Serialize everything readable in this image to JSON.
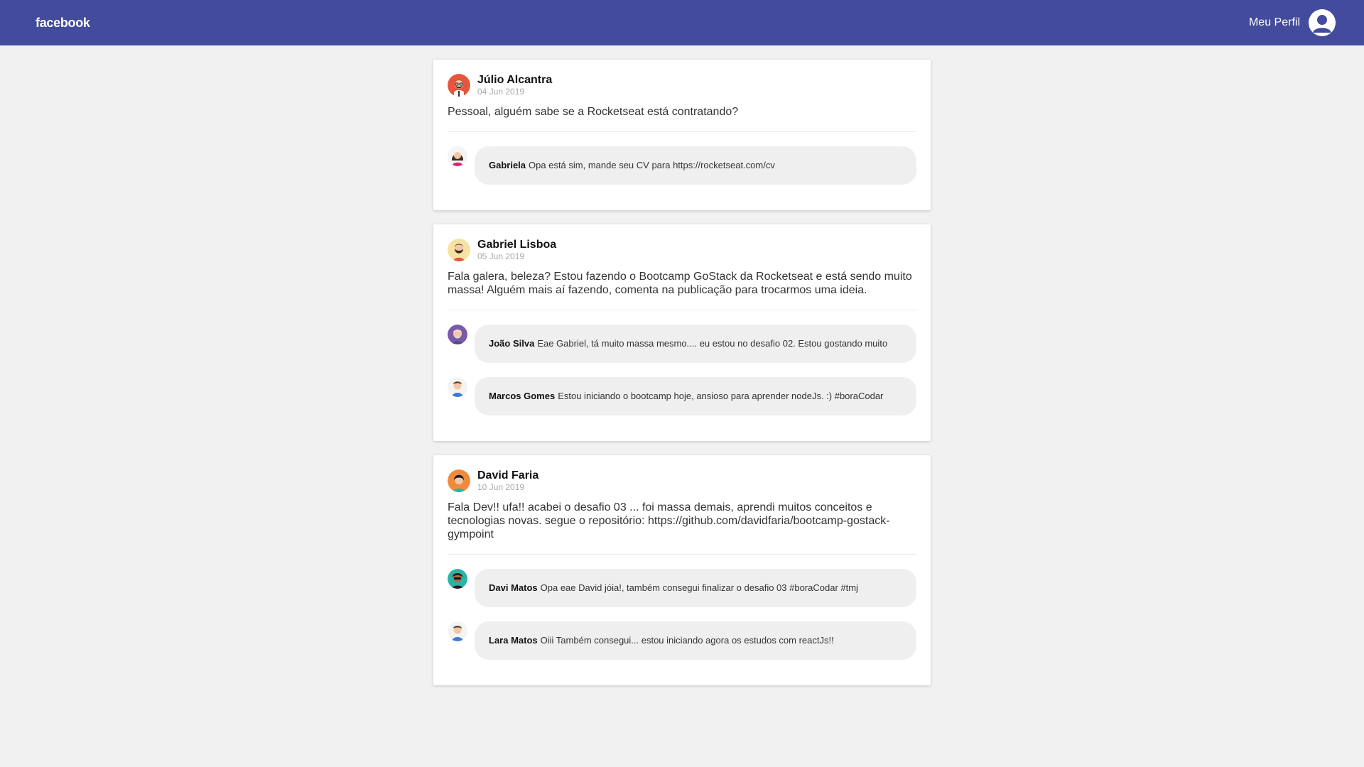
{
  "header": {
    "logo": "facebook",
    "profile_label": "Meu Perfil"
  },
  "posts": [
    {
      "author": "Júlio Alcantra",
      "date": "04 Jun 2019",
      "content": "Pessoal, alguém sabe se a Rocketseat está contratando?",
      "comments": [
        {
          "author": "Gabriela",
          "text": "Opa está sim, mande seu CV para https://rocketseat.com/cv"
        }
      ]
    },
    {
      "author": "Gabriel Lisboa",
      "date": "05 Jun 2019",
      "content": "Fala galera, beleza? Estou fazendo o Bootcamp GoStack da Rocketseat e está sendo muito massa! Alguém mais aí fazendo, comenta na publicação para trocarmos uma ideia.",
      "comments": [
        {
          "author": "João Silva",
          "text": "Eae Gabriel, tá muito massa mesmo.... eu estou no desafio 02. Estou gostando muito"
        },
        {
          "author": "Marcos Gomes",
          "text": "Estou iniciando o bootcamp hoje, ansioso para aprender nodeJs. :) #boraCodar"
        }
      ]
    },
    {
      "author": "David Faria",
      "date": "10 Jun 2019",
      "content": "Fala Dev!! ufa!! acabei o desafio 03 ... foi massa demais, aprendi muitos conceitos e tecnologias novas. segue o repositório: https://github.com/davidfaria/bootcamp-gostack-gympoint",
      "comments": [
        {
          "author": "Davi Matos",
          "text": "Opa eae David jóia!, também consegui finalizar o desafio 03 #boraCodar #tmj"
        },
        {
          "author": "Lara Matos",
          "text": "Oiii Também consegui... estou iniciando agora os estudos com reactJs!!"
        }
      ]
    }
  ]
}
